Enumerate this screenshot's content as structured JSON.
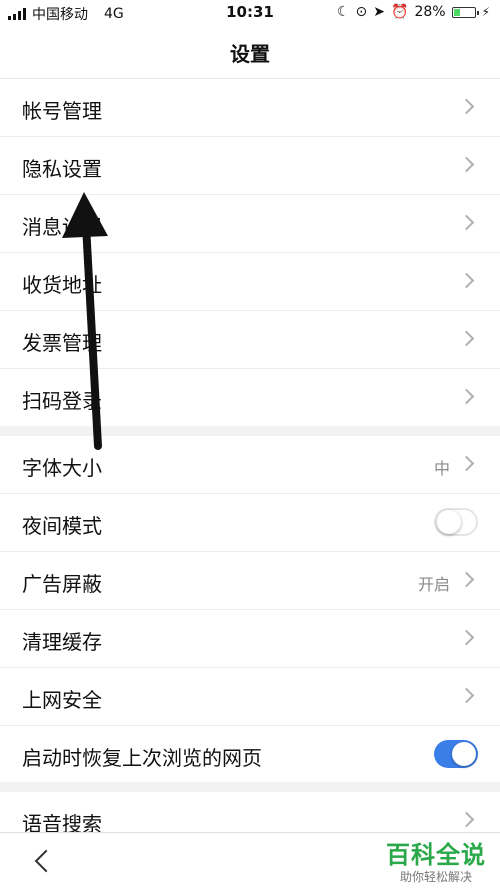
{
  "status_bar": {
    "carrier": "中国移动",
    "network": "4G",
    "time": "10:31",
    "battery_percent": "28%",
    "battery_level": 0.28
  },
  "header": {
    "title": "设置"
  },
  "group1": [
    {
      "label": "帐号管理"
    },
    {
      "label": "隐私设置"
    },
    {
      "label": "消息设置"
    },
    {
      "label": "收货地址"
    },
    {
      "label": "发票管理"
    },
    {
      "label": "扫码登录"
    }
  ],
  "group2": [
    {
      "label": "字体大小",
      "value": "中"
    },
    {
      "label": "夜间模式",
      "toggle": false
    },
    {
      "label": "广告屏蔽",
      "value": "开启"
    },
    {
      "label": "清理缓存"
    },
    {
      "label": "上网安全"
    },
    {
      "label": "启动时恢复上次浏览的网页",
      "toggle": true
    }
  ],
  "group3": [
    {
      "label": "语音搜索"
    }
  ],
  "watermark": {
    "title": "百科全说",
    "subtitle": "助你轻松解决"
  },
  "colors": {
    "toggle_on": "#3a7ee8",
    "watermark": "#2aa84a"
  }
}
